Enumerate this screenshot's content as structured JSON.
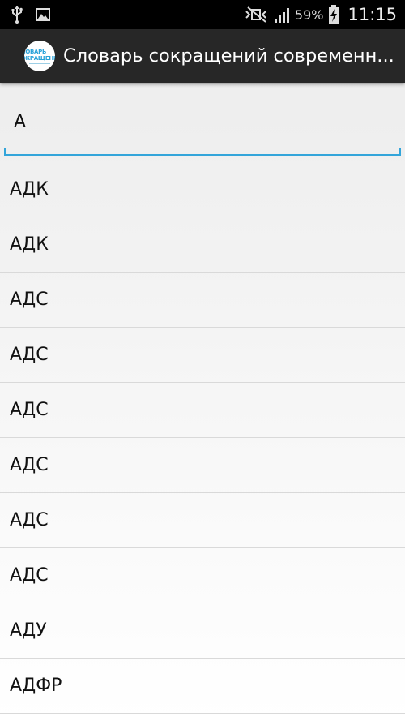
{
  "status_bar": {
    "battery_percent": "59%",
    "time": "11:15",
    "icons": [
      "usb-icon",
      "image-icon",
      "mute-icon",
      "signal-icon",
      "battery-charging-icon"
    ]
  },
  "action_bar": {
    "logo_text": "СЛОВАРЬ СОКРАЩЕНИЙ",
    "title": "Словарь сокращений современн..."
  },
  "search": {
    "value": "А"
  },
  "results": [
    "АДК",
    "АДК",
    "АДС",
    "АДС",
    "АДС",
    "АДС",
    "АДС",
    "АДС",
    "АДУ",
    "АДФР"
  ],
  "colors": {
    "accent": "#33a5da",
    "action_bar": "#272727",
    "status_bar": "#000000"
  }
}
